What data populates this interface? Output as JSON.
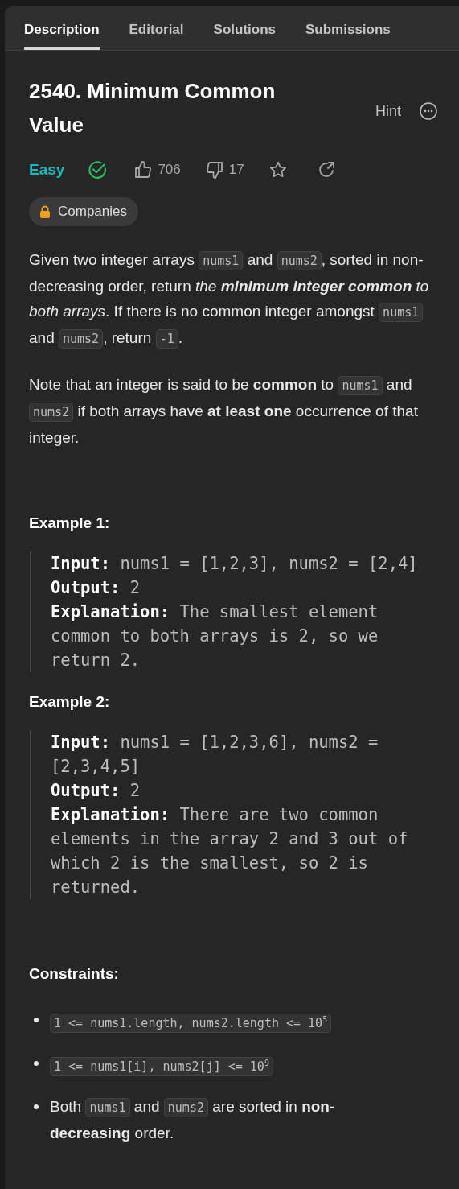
{
  "tabs": [
    {
      "label": "Description",
      "selected": true
    },
    {
      "label": "Editorial",
      "selected": false
    },
    {
      "label": "Solutions",
      "selected": false
    },
    {
      "label": "Submissions",
      "selected": false
    }
  ],
  "problem": {
    "title": "2540. Minimum Common Value",
    "hint": "Hint",
    "difficulty": "Easy",
    "solved": true,
    "likes": "706",
    "dislikes": "17",
    "companies": "Companies"
  },
  "paragraphs": [
    [
      {
        "kind": "text",
        "text": "Given two integer arrays "
      },
      {
        "kind": "code",
        "text": "nums1"
      },
      {
        "kind": "text",
        "text": " and "
      },
      {
        "kind": "code",
        "text": "nums2"
      },
      {
        "kind": "text",
        "text": ", sorted in non-decreasing order, return *the* "
      },
      {
        "kind": "strong_italic",
        "text": "minimum integer common"
      },
      {
        "kind": "text",
        "text": " *to both arrays*. If there is no common integer amongst "
      },
      {
        "kind": "code",
        "text": "nums1"
      },
      {
        "kind": "text",
        "text": " and "
      },
      {
        "kind": "code",
        "text": "nums2"
      },
      {
        "kind": "text",
        "text": ", return "
      },
      {
        "kind": "code",
        "text": "-1"
      },
      {
        "kind": "text",
        "text": "."
      }
    ],
    [
      {
        "kind": "text",
        "text": "Note that an integer is said to be **common** to "
      },
      {
        "kind": "code",
        "text": "nums1"
      },
      {
        "kind": "text",
        "text": " and "
      },
      {
        "kind": "code",
        "text": "nums2"
      },
      {
        "kind": "text",
        "text": " if both arrays have **at least one** occurrence of that integer."
      }
    ]
  ],
  "examples": [
    {
      "heading": "Example 1:",
      "lines": [
        {
          "label": "Input:",
          "text": "nums1 = [1,2,3], nums2 = [2,4]"
        },
        {
          "label": "Output:",
          "text": "2"
        },
        {
          "label": "Explanation:",
          "text": "The smallest element common to both arrays is 2, so we return 2."
        }
      ]
    },
    {
      "heading": "Example 2:",
      "lines": [
        {
          "label": "Input:",
          "text": "nums1 = [1,2,3,6], nums2 = [2,3,4,5]"
        },
        {
          "label": "Output:",
          "text": "2"
        },
        {
          "label": "Explanation:",
          "text": "There are two common elements in the array 2 and 3 out of which 2 is the smallest, so 2 is returned."
        }
      ]
    }
  ],
  "constraints": {
    "heading": "Constraints:",
    "items": [
      [
        {
          "kind": "code",
          "text": "1 <= nums1.length, nums2.length <= 10$^{5}$"
        }
      ],
      [
        {
          "kind": "code",
          "text": "1 <= nums1[i], nums2[j] <= 10$^{9}$"
        }
      ],
      [
        {
          "kind": "text",
          "text": "Both "
        },
        {
          "kind": "code",
          "text": "nums1"
        },
        {
          "kind": "text",
          "text": " and "
        },
        {
          "kind": "code",
          "text": "nums2"
        },
        {
          "kind": "text",
          "text": " are sorted in **non-decreasing** order."
        }
      ]
    ]
  }
}
